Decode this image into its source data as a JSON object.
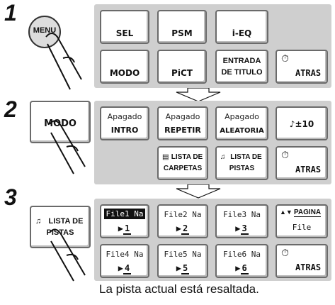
{
  "steps": [
    "1",
    "2",
    "3"
  ],
  "step1": {
    "menu_button": "MENU",
    "row1": [
      "SEL",
      "PSM",
      "i-EQ"
    ],
    "row2": [
      "MODO",
      "PiCT",
      "ENTRADA",
      "DE TITULO",
      "ATRAS"
    ]
  },
  "step2": {
    "pressed_button": "MODO",
    "row1": [
      {
        "top": "Apagado",
        "bottom": "INTRO"
      },
      {
        "top": "Apagado",
        "bottom": "REPETIR"
      },
      {
        "top": "Apagado",
        "bottom": "ALEATORIA"
      },
      {
        "top": "",
        "bottom": "♪±10"
      }
    ],
    "row2": [
      {
        "line1": "LISTA DE",
        "line2": "CARPETAS"
      },
      {
        "line1": "LISTA DE",
        "line2": "PISTAS"
      },
      {
        "line1": "",
        "line2": "ATRAS"
      }
    ]
  },
  "step3": {
    "pressed_line1": "LISTA DE",
    "pressed_line2": "PISTAS",
    "row1": [
      {
        "top": "File1 Na",
        "bottom": "1"
      },
      {
        "top": "File2 Na",
        "bottom": "2"
      },
      {
        "top": "File3 Na",
        "bottom": "3"
      },
      {
        "top": "PAGINA",
        "bottom": "File"
      }
    ],
    "row2": [
      {
        "top": "File4 Na",
        "bottom": "4"
      },
      {
        "top": "File5 Na",
        "bottom": "5"
      },
      {
        "top": "File6 Na",
        "bottom": "6"
      },
      {
        "top": "",
        "bottom": "ATRAS"
      }
    ]
  },
  "caption": "La pista actual está resaltada."
}
